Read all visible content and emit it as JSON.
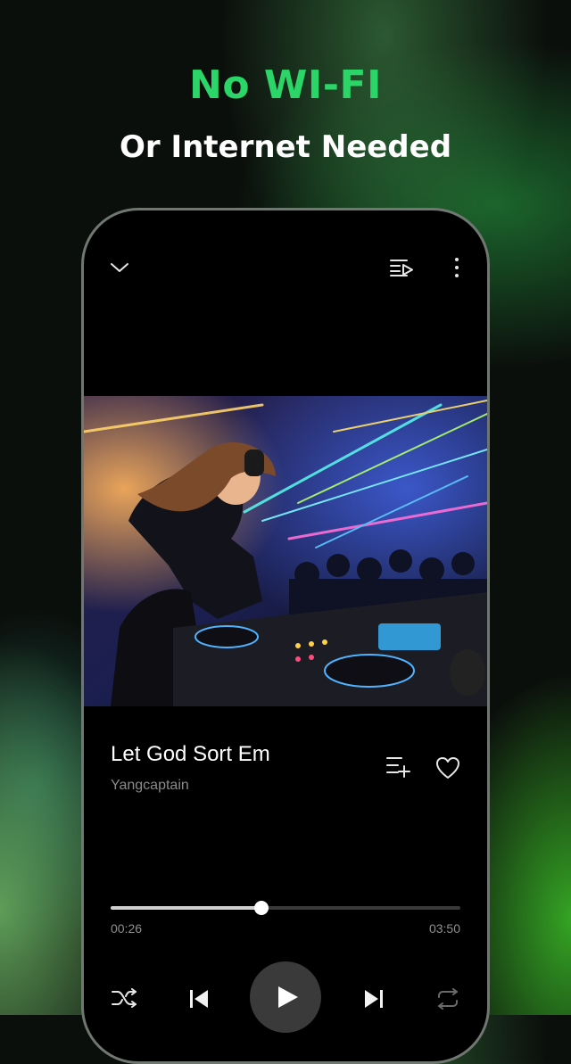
{
  "promo": {
    "headline": "No WI-FI",
    "subline": "Or Internet Needed",
    "headline_color": "#2bd567"
  },
  "player": {
    "header": {
      "collapse_icon": "chevron-down-icon",
      "queue_icon": "playlist-play-icon",
      "more_icon": "more-vertical-icon"
    },
    "artwork": {
      "description_icon": "album-art-image"
    },
    "track": {
      "title": "Let God Sort Em",
      "artist": "Yangcaptain",
      "add_to_playlist_icon": "playlist-add-icon",
      "favorite_icon": "heart-icon"
    },
    "progress": {
      "elapsed": "00:26",
      "duration": "03:50",
      "fraction": 0.43
    },
    "controls": {
      "shuffle_icon": "shuffle-icon",
      "previous_icon": "skip-previous-icon",
      "play_icon": "play-icon",
      "next_icon": "skip-next-icon",
      "repeat_icon": "repeat-icon"
    }
  }
}
